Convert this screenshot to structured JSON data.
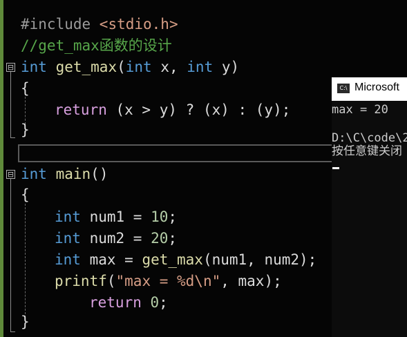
{
  "editor": {
    "lines": [
      {
        "pre": "#include ",
        "inc": "<stdio.h>"
      },
      {
        "comment": "//get_max函数的设计"
      },
      {
        "kw": "int",
        "fn": "get_max",
        "open": "(",
        "kw2": "int",
        "a": " x, ",
        "kw3": "int",
        "b": " y)"
      },
      {
        "text": "{"
      },
      {
        "ctl": "return",
        "text": " (x > y) ? (x) : (y);"
      },
      {
        "text": "}"
      },
      {
        "kw": "int",
        "fn": "main",
        "text": "()"
      },
      {
        "text": "{"
      },
      {
        "kw": "int",
        "text": " num1 = ",
        "num": "10",
        "end": ";"
      },
      {
        "kw": "int",
        "text": " num2 = ",
        "num": "20",
        "end": ";"
      },
      {
        "kw": "int",
        "text": " max = ",
        "fn": "get_max",
        "end": "(num1, num2);"
      },
      {
        "fn": "printf",
        "open": "(",
        "str": "\"max = %d\\n\"",
        "end": ", max);"
      },
      {
        "ctl": "return",
        "text": " ",
        "num": "0",
        "end": ";"
      },
      {
        "text": "}"
      }
    ],
    "fold_glyph": "⊟"
  },
  "console": {
    "title": "Microsoft",
    "icon_label": "C:\\",
    "output": [
      "max = 20",
      "",
      "D:\\C\\code\\2",
      "按任意键关闭"
    ]
  }
}
